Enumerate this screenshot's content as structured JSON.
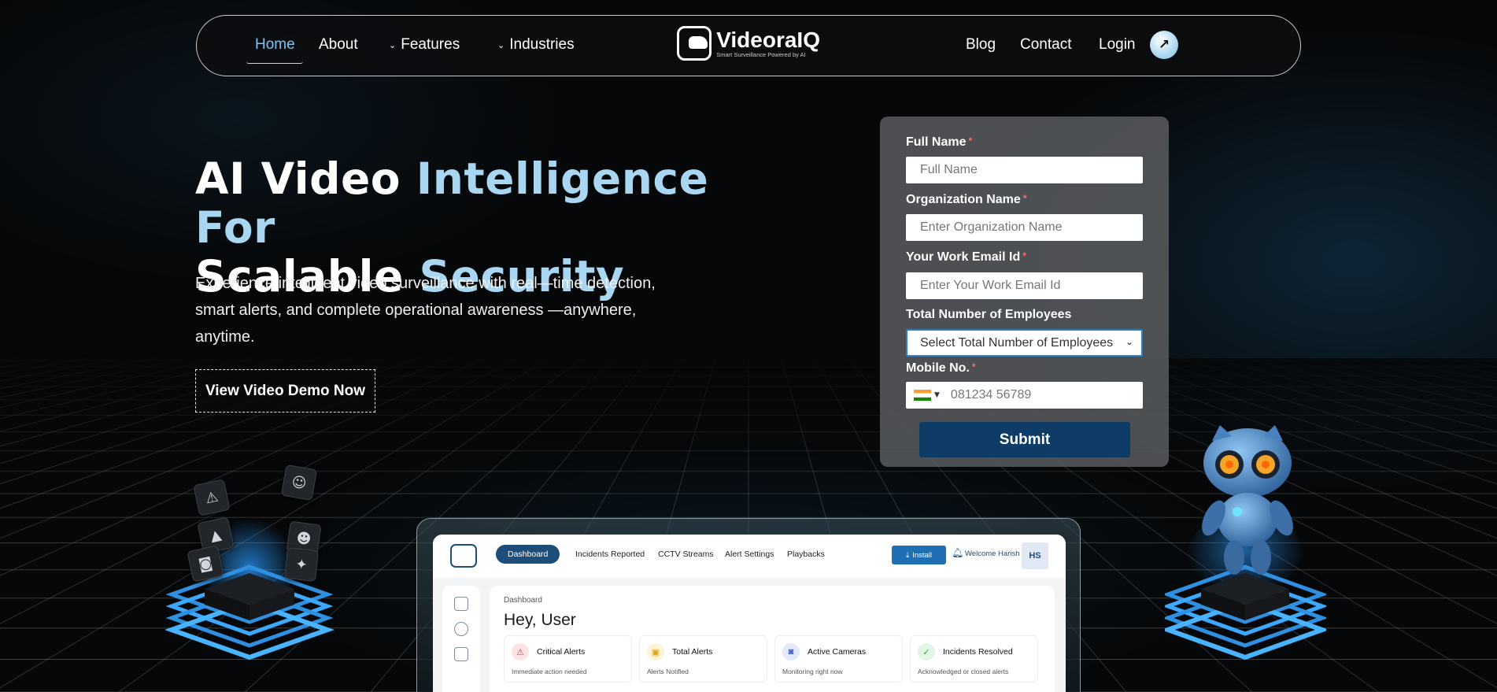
{
  "nav": {
    "home": "Home",
    "about": "About",
    "features": "Features",
    "industries": "Industries",
    "blog": "Blog",
    "contact": "Contact",
    "login": "Login",
    "login_icon": "arrow-up-right-icon"
  },
  "logo": {
    "name": "VideoraIQ",
    "tagline": "Smart Surveillance Powered by AI"
  },
  "hero": {
    "title_line1_white": "AI Video ",
    "title_line1_accent": "Intelligence For",
    "title_line2_white": "Scalable ",
    "title_line2_accent": "Security",
    "subtitle": "Experience intelligent video surveillance with real—time detection, smart alerts, and complete operational awareness —anywhere, anytime.",
    "cta": "View Video Demo Now"
  },
  "form": {
    "full_name_label": "Full Name",
    "full_name_placeholder": "Full Name",
    "org_label": "Organization Name",
    "org_placeholder": "Enter Organization Name",
    "email_label": "Your Work Email Id",
    "email_placeholder": "Enter Your Work Email Id",
    "employees_label": "Total Number of Employees",
    "employees_selected": "Select Total Number of Employees",
    "mobile_label": "Mobile No.",
    "mobile_placeholder": "081234 56789",
    "required_mark": "*",
    "submit": "Submit"
  },
  "dashboard": {
    "tabs": [
      "Dashboard",
      "Incidents Reported",
      "CCTV Streams",
      "Alert Settings",
      "Playbacks"
    ],
    "install": "Install",
    "welcome": "Welcome Harish",
    "avatar": "HS",
    "breadcrumb": "Dashboard",
    "greeting": "Hey, User",
    "stats": [
      {
        "title": "Critical Alerts",
        "sub": "Immediate action needed",
        "icon": "warning-icon"
      },
      {
        "title": "Total Alerts",
        "sub": "Alerts Notified",
        "icon": "alert-box-icon"
      },
      {
        "title": "Active Cameras",
        "sub": "Monitoring right now",
        "icon": "camera-icon"
      },
      {
        "title": "Incidents Resolved",
        "sub": "Acknowledged or closed alerts",
        "icon": "check-circle-icon"
      }
    ]
  },
  "colors": {
    "accent": "#a9d7f2",
    "nav_active": "#7fc3ef",
    "submit_bg": "#0f3c66",
    "dash_primary": "#1d4e7a"
  }
}
